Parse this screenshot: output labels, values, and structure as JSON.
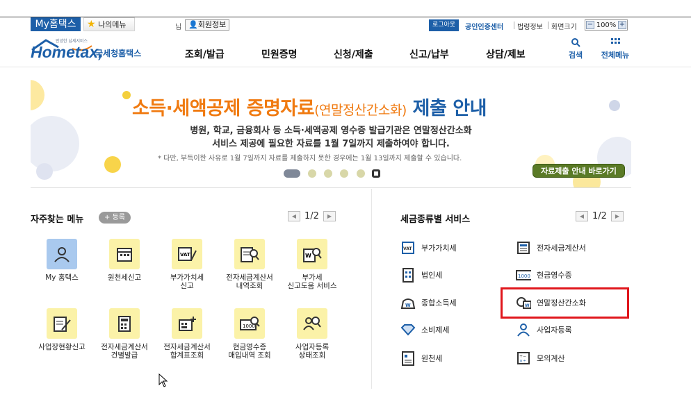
{
  "util_bar": {
    "my_hometax": "My홈택스",
    "my_menu": "나의메뉴",
    "nim": "님",
    "member_info": "회원정보",
    "logout": "로그아웃",
    "cert_center": "공인인증센터",
    "law_info": "법령정보",
    "zoom_label": "화면크기",
    "zoom_minus": "−",
    "zoom_value": "100%",
    "zoom_plus": "+"
  },
  "logo": {
    "sub": "안녕한 납세서비스",
    "home": "Hometax,",
    "nts": "국세청홈택스"
  },
  "gnb": [
    "조회/발급",
    "민원증명",
    "신청/제출",
    "신고/납부",
    "상담/제보"
  ],
  "header_utils": {
    "search": "검색",
    "all_menu": "전체메뉴"
  },
  "banner": {
    "title_main": "소득·세액공제 증명자료",
    "title_paren": "(연말정산간소화)",
    "title_blue": " 제출 안내",
    "line1": "병원, 학교, 금융회사 등 소득·세액공제 영수증 발급기관은 연말정산간소화",
    "line2": "서비스 제공에 필요한 자료를 1월 7일까지 제출하여야 합니다.",
    "note": "* 다만, 부득이한 사유로 1월 7일까지 자료를 제출하지 못한 경우에는 1월 13일까지 제출할 수 있습니다.",
    "button": "자료제출 안내 바로가기"
  },
  "favorites": {
    "title": "자주찾는 메뉴",
    "register": "등록",
    "page": "1/2",
    "items": [
      {
        "label": "My 홈택스",
        "icon": "user-icon"
      },
      {
        "label": "원천세신고",
        "icon": "calendar-icon"
      },
      {
        "label": "부가가치세\n신고",
        "icon": "vat-pen-icon"
      },
      {
        "label": "전자세금계산서\n내역조회",
        "icon": "invoice-search-icon"
      },
      {
        "label": "부가세\n신고도움 서비스",
        "icon": "w-search-icon"
      },
      {
        "label": "사업장현황신고",
        "icon": "document-pen-icon"
      },
      {
        "label": "전자세금계산서\n건별발급",
        "icon": "calculator-doc-icon"
      },
      {
        "label": "전자세금계산서\n합계표조회",
        "icon": "keyboard-plus-icon"
      },
      {
        "label": "현금영수증\n매입내역 조회",
        "icon": "receipt-search-icon"
      },
      {
        "label": "사업자등록\n상태조회",
        "icon": "people-search-icon"
      }
    ]
  },
  "services": {
    "title": "세금종류별 서비스",
    "page": "1/2",
    "left": [
      {
        "label": "부가가치세",
        "icon": "vat-icon"
      },
      {
        "label": "법인세",
        "icon": "building-icon"
      },
      {
        "label": "종합소득세",
        "icon": "money-bag-icon"
      },
      {
        "label": "소비제세",
        "icon": "diamond-icon"
      },
      {
        "label": "원천세",
        "icon": "tax-doc-icon"
      }
    ],
    "right": [
      {
        "label": "전자세금계산서",
        "icon": "e-invoice-icon"
      },
      {
        "label": "현금영수증",
        "icon": "cash-receipt-icon"
      },
      {
        "label": "연말정산간소화",
        "icon": "year-end-icon"
      },
      {
        "label": "사업자등록",
        "icon": "person-icon"
      },
      {
        "label": "모의계산",
        "icon": "calculator-icon"
      }
    ]
  },
  "colors": {
    "brand_blue": "#1d5fa8",
    "banner_orange": "#f07a10",
    "highlight_red": "#e0161c",
    "tile_yellow": "#fbf2a8"
  }
}
